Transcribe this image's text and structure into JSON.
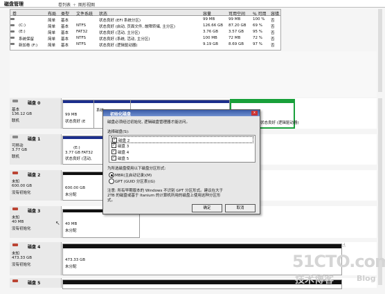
{
  "window": {
    "title": "磁盘管理",
    "view_list": "卷列表",
    "view_sep": "+",
    "view_graph": "图形视图"
  },
  "table": {
    "headers": [
      "卷",
      "布局",
      "类型",
      "文件系统",
      "状态",
      "容量",
      "可用空间",
      "% 可用",
      "容错",
      "开销"
    ],
    "rows": [
      [
        "",
        "简单",
        "基本",
        "",
        "状态良好 (EFI 系统分区)",
        "99 MB",
        "99 MB",
        "100 %",
        "否",
        "0%"
      ],
      [
        "(C:)",
        "简单",
        "基本",
        "NTFS",
        "状态良好 (启动, 页面文件, 故障转储, 主分区)",
        "126.66 GB",
        "87.20 GB",
        "69 %",
        "否",
        "0%"
      ],
      [
        "(E:)",
        "简单",
        "基本",
        "FAT32",
        "状态良好 (活动, 主分区)",
        "3.76 GB",
        "3.57 GB",
        "95 %",
        "否",
        "0%"
      ],
      [
        "系统保留",
        "简单",
        "基本",
        "NTFS",
        "状态良好 (系统, 活动, 主分区)",
        "100 MB",
        "72 MB",
        "72 %",
        "否",
        "0%"
      ],
      [
        "新加卷 (F:)",
        "简单",
        "基本",
        "NTFS",
        "状态良好 (逻辑驱动器)",
        "9.19 GB",
        "8.69 GB",
        "97 %",
        "否",
        "0%"
      ]
    ]
  },
  "disks": [
    {
      "title": "磁盘 0",
      "lines": [
        "基本",
        "136.12 GB",
        "联机"
      ],
      "parts": [
        {
          "lines": [
            "99 MB",
            "状态良好 (E"
          ]
        },
        {
          "lines": [
            "系统",
            "",
            ""
          ]
        },
        {
          "lines": [
            "",
            ""
          ]
        },
        {
          "lines": [
            "状态良好 (逻辑驱动器)"
          ]
        }
      ]
    },
    {
      "title": "磁盘 1",
      "lines": [
        "可移动",
        "3.77 GB",
        "联机"
      ],
      "parts": [
        {
          "lines": [
            "(E:)",
            "3.77 GB FAT32",
            "状态良好 (活动,"
          ]
        }
      ]
    },
    {
      "title": "磁盘 2",
      "lines": [
        "未知",
        "600.00 GB",
        "没有初始化"
      ],
      "parts": [
        {
          "lines": [
            "600.00 GB",
            "未分配"
          ]
        }
      ]
    },
    {
      "title": "磁盘 3",
      "lines": [
        "未知",
        "40 MB",
        "没有初始化"
      ],
      "parts": [
        {
          "lines": [
            "40 MB",
            "未分配"
          ]
        }
      ]
    },
    {
      "title": "磁盘 4",
      "lines": [
        "未知",
        "473.33 GB",
        "没有初始化"
      ],
      "parts": [
        {
          "lines": [
            "473.33 GB",
            "未分配"
          ]
        }
      ]
    },
    {
      "title": "磁盘 5",
      "lines": [],
      "parts": []
    }
  ],
  "dialog": {
    "title": "初始化磁盘",
    "close": "x",
    "intro": "磁盘必须经过初始化, 逻辑磁盘管理器才能访问。",
    "select_label": "选择磁盘(S):",
    "disks": [
      {
        "label": "磁盘 2",
        "checked": true,
        "selected": true
      },
      {
        "label": "磁盘 3",
        "checked": true,
        "selected": false
      },
      {
        "label": "磁盘 4",
        "checked": true,
        "selected": false
      },
      {
        "label": "磁盘 5",
        "checked": true,
        "selected": false
      }
    ],
    "style_label": "为所选磁盘使用以下磁盘分区形式:",
    "options": [
      {
        "label": "MBR(主启动记录)(M)",
        "selected": true
      },
      {
        "label": "GPT (GUID 分区表)(G)",
        "selected": false
      }
    ],
    "note": [
      "注意: 所有早期版本的 Windows 不识别 GPT 分区形式。建议在大于",
      "2TB 的磁盘或基于 Itanium 的计算机所用的磁盘上使用这种分区形",
      "式。"
    ],
    "ok": "确定",
    "cancel": "取消"
  },
  "watermark": {
    "main": "51CTO.com",
    "sub": "技术博客",
    "blog": "Blog"
  },
  "icons": {
    "check": "✓",
    "cursor": "↖",
    "hand": "☝"
  }
}
